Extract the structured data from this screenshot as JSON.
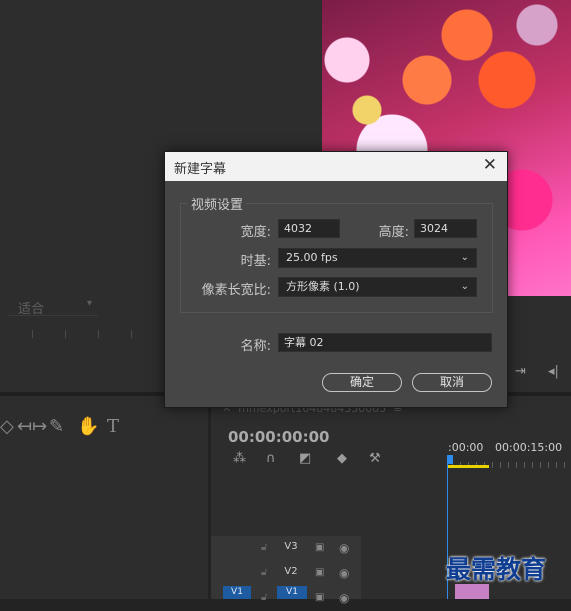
{
  "source_monitor": {
    "fit_select": "适合"
  },
  "dialog": {
    "title": "新建字幕",
    "close_glyph": "✕",
    "video_settings": {
      "group_label": "视频设置",
      "width_label": "宽度:",
      "width_value": "4032",
      "height_label": "高度:",
      "height_value": "3024",
      "timebase_label": "时基:",
      "timebase_value": "25.00 fps",
      "pixel_aspect_label": "像素长宽比:",
      "pixel_aspect_value": "方形像素 (1.0)"
    },
    "name_label": "名称:",
    "name_value": "字幕 02",
    "ok_label": "确定",
    "cancel_label": "取消"
  },
  "timeline": {
    "tab_title": "mmexport1648484350005",
    "timecode": "00:00:00:00",
    "ruler_labels": [
      ":00:00",
      "00:00:15:00"
    ],
    "tracks": [
      {
        "name": "V3"
      },
      {
        "name": "V2"
      },
      {
        "name": "V1",
        "source_patch": "V1"
      }
    ]
  },
  "watermark": "最需教育",
  "icons": {
    "tools": [
      "ripple-edit-icon",
      "slip-icon",
      "pen-icon",
      "hand-icon",
      "type-icon"
    ],
    "timeline": [
      "snap-icon",
      "magnet-icon",
      "marker-icon",
      "add-marker-icon",
      "settings-wrench-icon"
    ],
    "dropdown": "chevron-down-icon"
  },
  "colors": {
    "accent_blue": "#2d8ceb",
    "work_area_yellow": "#e6d300",
    "track_blue": "#1f5ba1",
    "clip_pink": "#c780c3"
  }
}
